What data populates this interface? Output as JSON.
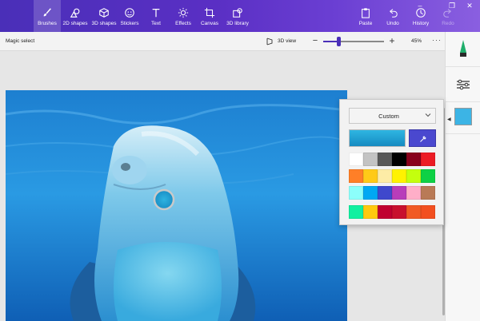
{
  "toolbar": {
    "tools": [
      {
        "label": "Brushes",
        "icon": "brush-icon",
        "active": true
      },
      {
        "label": "2D shapes",
        "icon": "shapes-2d-icon"
      },
      {
        "label": "3D shapes",
        "icon": "cube-icon"
      },
      {
        "label": "Stickers",
        "icon": "sticker-icon"
      },
      {
        "label": "Text",
        "icon": "text-icon"
      },
      {
        "label": "Effects",
        "icon": "effects-icon"
      },
      {
        "label": "Canvas",
        "icon": "canvas-icon"
      },
      {
        "label": "3D library",
        "icon": "library-icon"
      }
    ],
    "actions": [
      {
        "label": "Paste",
        "icon": "paste-icon"
      },
      {
        "label": "Undo",
        "icon": "undo-icon"
      },
      {
        "label": "History",
        "icon": "history-icon"
      },
      {
        "label": "Redo",
        "icon": "redo-icon",
        "disabled": true
      }
    ]
  },
  "subbar": {
    "magic_select": "Magic select",
    "view3d": "3D view",
    "zoom_percent": "45%",
    "zoom_level": 0.25,
    "more": "···"
  },
  "color_picker": {
    "mode": "Custom",
    "current_color": "#23a9de",
    "eyedropper_color": "#4a48cf",
    "swatches": [
      [
        "#ffffff",
        "#c3c3c3",
        "#585858",
        "#000000",
        "#88001b",
        "#ec1c24"
      ],
      [
        "#ff7f27",
        "#ffca18",
        "#fdeca6",
        "#fff200",
        "#c4ff0e",
        "#0ed145"
      ],
      [
        "#8cfffb",
        "#00a8f3",
        "#3f48cc",
        "#b83dba",
        "#ffaec8",
        "#b97a56"
      ],
      [
        "#11f0a0",
        "#ffc90e",
        "#c00030",
        "#c8102e",
        "#f15a24",
        "#f24f1f"
      ]
    ]
  },
  "colors": {
    "ribbon": "#4a2fb8",
    "accent": "#4a2fb8",
    "selected_side_color": "#3cb4e5"
  }
}
